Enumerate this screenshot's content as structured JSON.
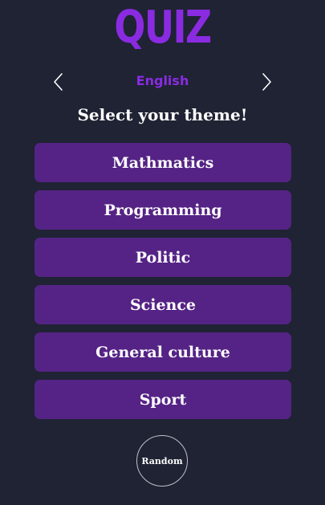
{
  "app": {
    "title": "QUIZ"
  },
  "language": {
    "current": "English",
    "prev_icon": "chevron-left-icon",
    "next_icon": "chevron-right-icon"
  },
  "prompt": "Select your theme!",
  "themes": [
    {
      "label": "Mathmatics"
    },
    {
      "label": "Programming"
    },
    {
      "label": "Politic"
    },
    {
      "label": "Science"
    },
    {
      "label": "General culture"
    },
    {
      "label": "Sport"
    }
  ],
  "random": {
    "label": "Random"
  },
  "colors": {
    "background": "#1f2333",
    "accent": "#8a2be2",
    "button": "#552385",
    "text": "#ffffff"
  }
}
